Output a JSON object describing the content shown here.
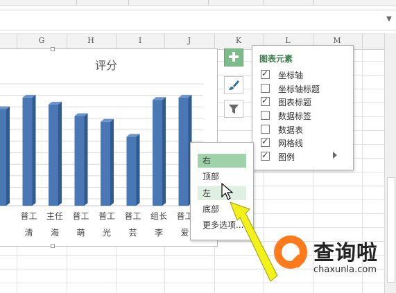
{
  "columns": [
    "G",
    "H",
    "I",
    "J",
    "K",
    "L",
    "M"
  ],
  "chart": {
    "title": "评分",
    "categories": [
      {
        "top": "",
        "bottom": ""
      },
      {
        "top": "普工",
        "bottom": "清"
      },
      {
        "top": "主任",
        "bottom": "海"
      },
      {
        "top": "普工",
        "bottom": "萌"
      },
      {
        "top": "普工",
        "bottom": "光"
      },
      {
        "top": "普工",
        "bottom": "芸"
      },
      {
        "top": "组长",
        "bottom": "李"
      },
      {
        "top": "普工",
        "bottom": "爱"
      }
    ],
    "bar_color": "#4a78b5"
  },
  "chart_data": {
    "type": "bar",
    "title": "评分",
    "categories": [
      "",
      "普工 清",
      "主任 海",
      "普工 萌",
      "普工 光",
      "普工 芸",
      "组长 李",
      "普工 爱"
    ],
    "values": [
      78,
      88,
      82,
      72,
      67,
      54,
      86,
      88
    ],
    "ylim": [
      0,
      100
    ],
    "grid": true,
    "legend": "none"
  },
  "side_buttons": [
    {
      "name": "chart-elements-button",
      "icon": "plus-icon"
    },
    {
      "name": "chart-styles-button",
      "icon": "brush-icon"
    },
    {
      "name": "chart-filters-button",
      "icon": "filter-icon"
    }
  ],
  "elements_panel": {
    "title": "图表元素",
    "items": [
      {
        "label": "坐标轴",
        "checked": true
      },
      {
        "label": "坐标轴标题",
        "checked": false
      },
      {
        "label": "图表标题",
        "checked": true
      },
      {
        "label": "数据标签",
        "checked": false
      },
      {
        "label": "数据表",
        "checked": false
      },
      {
        "label": "网格线",
        "checked": true
      },
      {
        "label": "图例",
        "checked": true
      }
    ]
  },
  "legend_menu": {
    "items": [
      {
        "label": "右",
        "state": "selected"
      },
      {
        "label": "顶部",
        "state": "normal"
      },
      {
        "label": "左",
        "state": "hover"
      },
      {
        "label": "底部",
        "state": "normal"
      },
      {
        "label": "更多选项...",
        "state": "normal"
      }
    ]
  },
  "watermark": {
    "brand": "查询啦",
    "url": "chaxunla.com"
  },
  "colors": {
    "accent_green": "#7ebb8a",
    "selected_green": "#9fd2a9",
    "arrow_yellow": "#f2f21a",
    "logo_orange": "#ff7a1a"
  }
}
